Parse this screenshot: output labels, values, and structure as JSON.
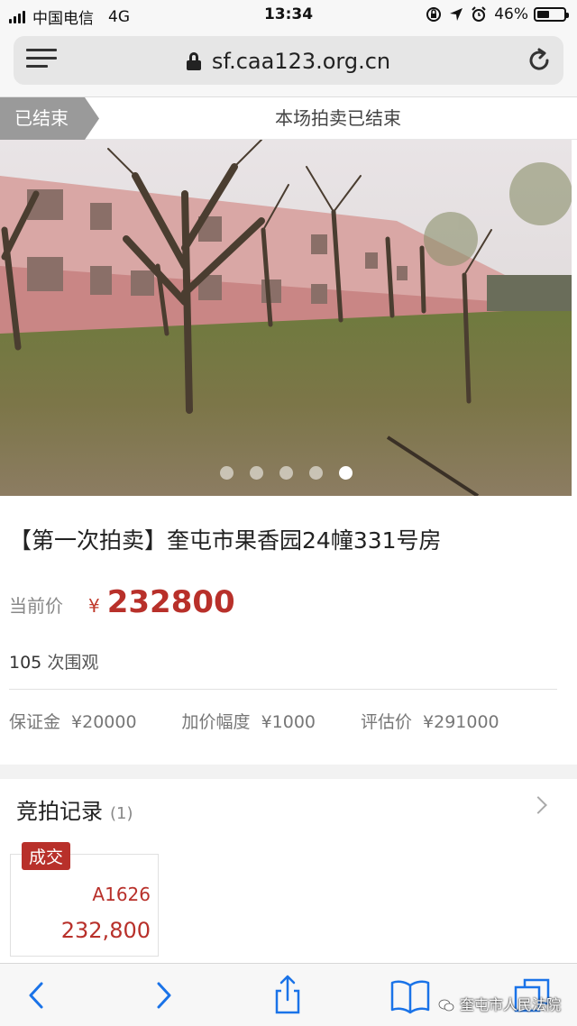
{
  "status_bar": {
    "carrier": "中国电信",
    "network": "4G",
    "time": "13:34",
    "battery_percent": "46%",
    "battery_level": 0.46
  },
  "browser": {
    "url": "sf.caa123.org.cn"
  },
  "banner": {
    "tag": "已结束",
    "message": "本场拍卖已结束"
  },
  "gallery": {
    "slide_count": 5,
    "active_index": 4
  },
  "lot": {
    "title": "【第一次拍卖】奎屯市果香园24幢331号房",
    "price_label": "当前价",
    "currency": "¥",
    "price": "232800",
    "views_count": "105",
    "views_suffix": "次围观",
    "fees": [
      {
        "label": "保证金",
        "value": "¥20000"
      },
      {
        "label": "加价幅度",
        "value": "¥1000"
      },
      {
        "label": "评估价",
        "value": "¥291000"
      }
    ]
  },
  "bids": {
    "title": "竞拍记录",
    "count": "(1)",
    "records": [
      {
        "badge": "成交",
        "bidder": "A1626",
        "amount": "232,800"
      }
    ]
  },
  "watermark": "奎屯市人民法院",
  "colors": {
    "accent_red": "#b8302a",
    "ended_gray": "#9a9a9a"
  }
}
